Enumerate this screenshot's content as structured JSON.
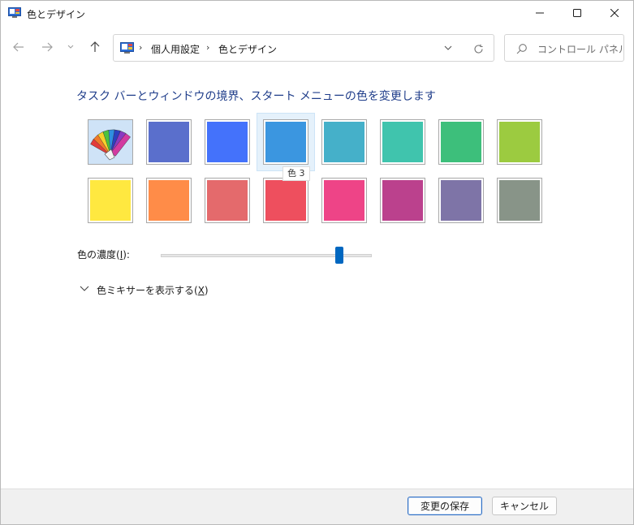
{
  "window": {
    "title": "色とデザイン"
  },
  "address": {
    "crumbs": [
      "個人用設定",
      "色とデザイン"
    ]
  },
  "search": {
    "placeholder": "コントロール パネルの..."
  },
  "main": {
    "heading": "タスク バーとウィンドウの境界、スタート メニューの色を変更します",
    "swatches_row1": [
      {
        "id": "custom",
        "color": "",
        "label": ""
      },
      {
        "id": "color-1",
        "color": "#5a6fcc"
      },
      {
        "id": "color-2",
        "color": "#4472fb"
      },
      {
        "id": "color-3",
        "color": "#3b96e0",
        "selected": true
      },
      {
        "id": "color-4",
        "color": "#45b0c9"
      },
      {
        "id": "color-5",
        "color": "#40c4ad"
      },
      {
        "id": "color-6",
        "color": "#3dbf7b"
      },
      {
        "id": "color-7",
        "color": "#9ccb40"
      }
    ],
    "swatches_row2": [
      {
        "id": "color-8",
        "color": "#ffe840"
      },
      {
        "id": "color-9",
        "color": "#ff8c48"
      },
      {
        "id": "color-10",
        "color": "#e46a6c"
      },
      {
        "id": "color-11",
        "color": "#ee4f5e"
      },
      {
        "id": "color-12",
        "color": "#ee4487"
      },
      {
        "id": "color-13",
        "color": "#bb418d"
      },
      {
        "id": "color-14",
        "color": "#7e74a7"
      },
      {
        "id": "color-15",
        "color": "#889488"
      }
    ],
    "tooltip": "色 3",
    "intensity": {
      "label_pre": "色の濃度(",
      "label_key": "I",
      "label_post": "):",
      "value": 0.86
    },
    "mixer": {
      "label_pre": "色ミキサーを表示する(",
      "label_key": "X",
      "label_post": ")"
    }
  },
  "footer": {
    "save_label": "変更の保存",
    "cancel_label": "キャンセル"
  },
  "colors": {
    "accent": "#0067c0",
    "heading": "#1f3d8a"
  }
}
